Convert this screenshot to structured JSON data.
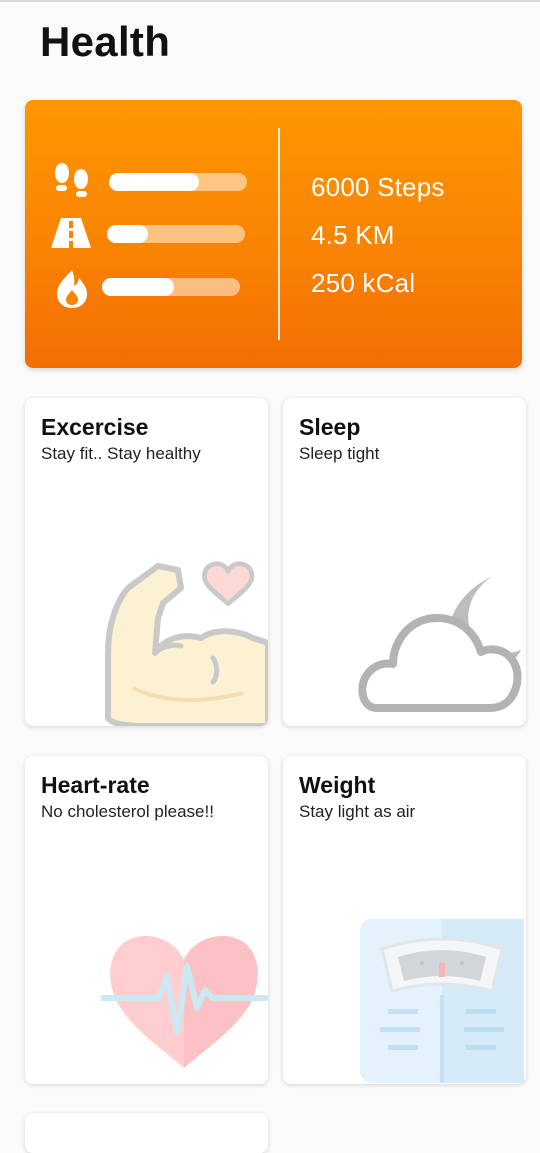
{
  "page": {
    "title": "Health"
  },
  "summary": {
    "metrics": [
      {
        "icon": "footsteps-icon",
        "label": "6000 Steps",
        "progress": 0.65
      },
      {
        "icon": "road-icon",
        "label": "4.5 KM",
        "progress": 0.3
      },
      {
        "icon": "flame-icon",
        "label": "250 kCal",
        "progress": 0.52
      }
    ],
    "accent": "#fb8c00"
  },
  "tiles": [
    {
      "id": "exercise",
      "title": "Excercise",
      "subtitle": "Stay fit.. Stay healthy",
      "icon": "flexed-arm-heart-icon"
    },
    {
      "id": "sleep",
      "title": "Sleep",
      "subtitle": "Sleep tight",
      "icon": "cloud-moon-icon"
    },
    {
      "id": "heart-rate",
      "title": "Heart-rate",
      "subtitle": "No cholesterol please!!",
      "icon": "heart-pulse-icon"
    },
    {
      "id": "weight",
      "title": "Weight",
      "subtitle": "Stay light as air",
      "icon": "weighing-scale-icon"
    }
  ]
}
